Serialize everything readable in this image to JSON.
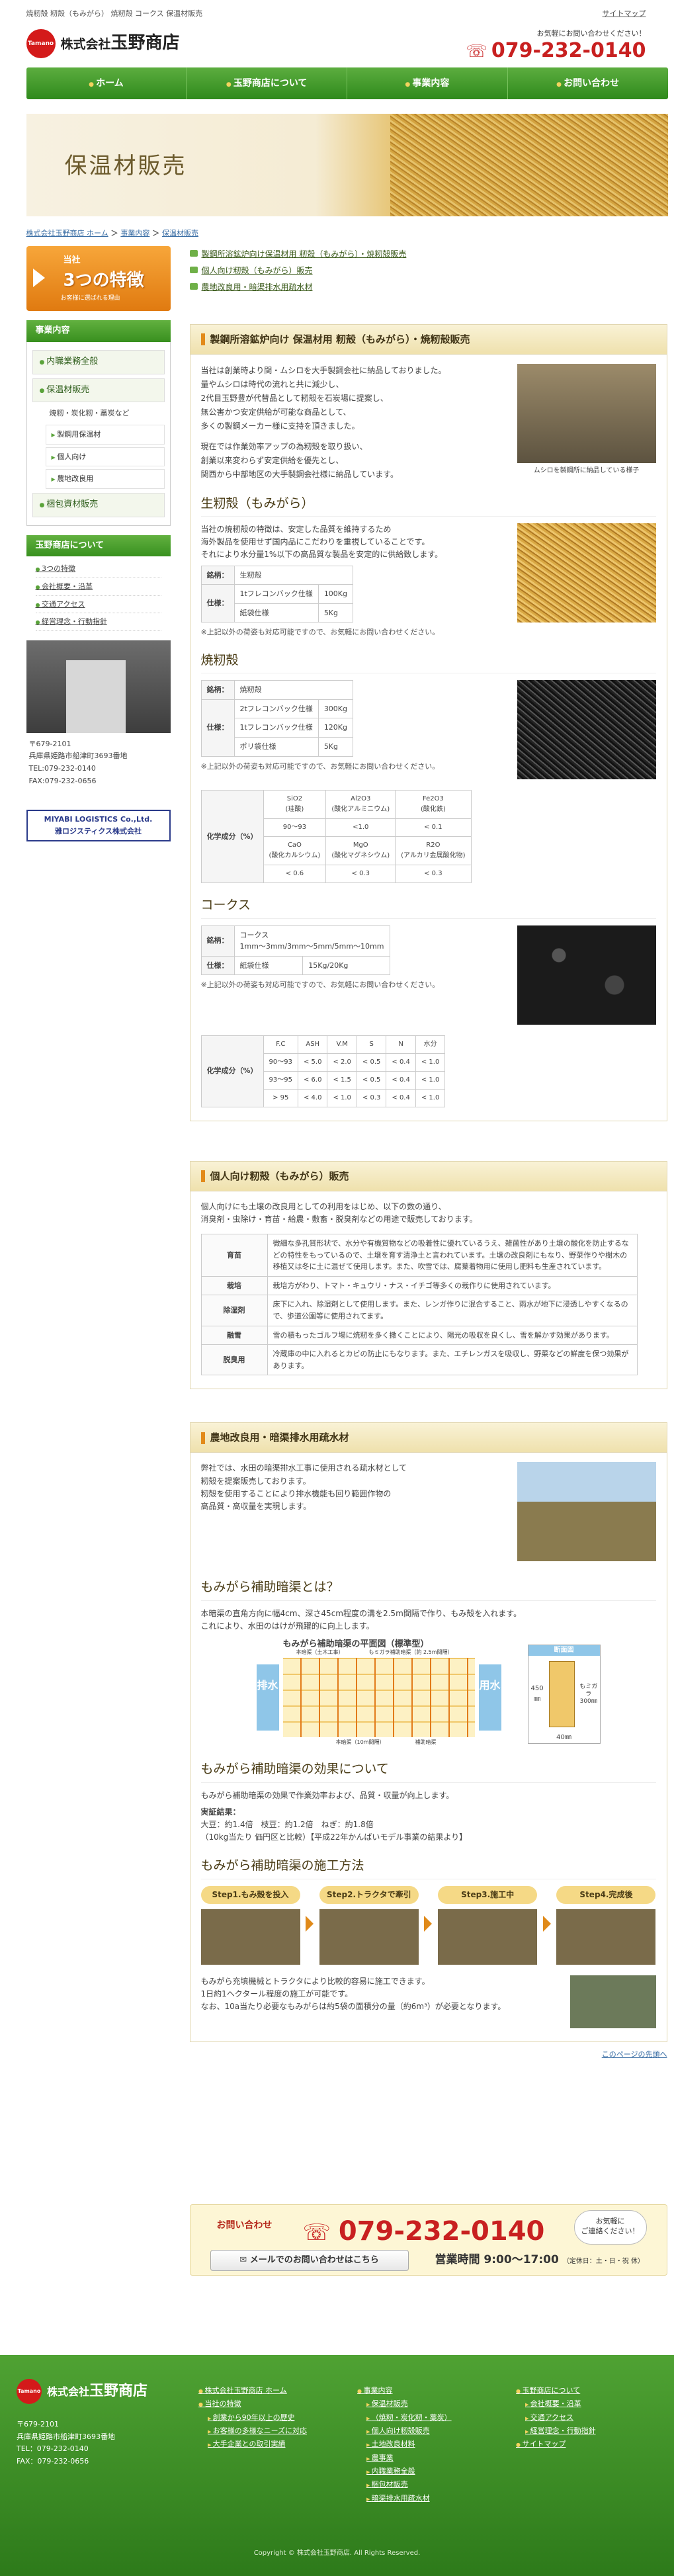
{
  "header": {
    "desc": "焼籾殻 籾殻（もみがら） 焼籾殻 コークス 保温材販売",
    "sitemap": "サイトマップ",
    "logo_mark": "Tamano",
    "company_prefix": "株式会社",
    "company_name": "玉野商店",
    "contact_label": "お気軽にお問い合わせください！",
    "tel": "079-232-0140"
  },
  "nav": [
    "ホーム",
    "玉野商店について",
    "事業内容",
    "お問い合わせ"
  ],
  "hero": {
    "title": "保温材販売"
  },
  "breadcrumb": {
    "home": "株式会社玉野商店 ホーム",
    "sep1": " ＞ ",
    "business": "事業内容",
    "sep2": " ＞ ",
    "current": "保温材販売"
  },
  "sidebar": {
    "three": {
      "line1": "当社",
      "line2": "3つの特徴",
      "line3": "お客様に選ばれる理由"
    },
    "biz_heading": "事業内容",
    "items": [
      {
        "label": "内職業務全般"
      },
      {
        "label": "保温材販売"
      },
      {
        "label": "梱包資材販売"
      }
    ],
    "sub_desc": "焼籾・炭化籾・藁炭など",
    "sub_items": [
      "製鋼用保温材",
      "個人向け",
      "農地改良用"
    ],
    "about_heading": "玉野商店について",
    "about_links": [
      "3つの特徴",
      "会社概要・沿革",
      "交通アクセス",
      "経営理念・行動指針"
    ],
    "addr": [
      "〒679-2101",
      "兵庫県姫路市船津町3693番地",
      "TEL:079-232-0140",
      "FAX:079-232-0656"
    ],
    "miyabi": [
      "MIYABI LOGISTICS Co.,Ltd.",
      "雅ロジスティクス株式会社"
    ]
  },
  "main": {
    "top_links": [
      "製鋼所溶鉱炉向け保温材用 籾殻（もみがら）・焼籾殻販売",
      "個人向け籾殻（もみがら）販売",
      "農地改良用・暗渠排水用疏水材"
    ],
    "sec1": {
      "title": "製鋼所溶鉱炉向け 保温材用 籾殻（もみがら）・焼籾殻販売",
      "intro": [
        "当社は創業時より関・ムシロを大手製鋼会社に納品しておりました。",
        "量やムシロは時代の流れと共に減少し、",
        "2代目玉野豊が代替品として籾殻を石炭場に提案し、",
        "無公害かつ安定供給が可能な商品として、",
        "多くの製鋼メーカー様に支持を頂きました。",
        "",
        "現在では作業効率アップの為籾殻を取り扱い、",
        "創業以来変わらず安定供給を優先とし、",
        "関西から中部地区の大手製鋼会社様に納品しています。"
      ],
      "photo_caption": "ムシロを製鋼所に納品している様子",
      "h_raw": "生籾殻（もみがら）",
      "raw_desc": [
        "当社の焼籾殻の特徴は、安定した品質を維持するため",
        "海外製品を使用せず国内品にこだわりを重視していることです。",
        "それにより水分量1%以下の高品質な製品を安定的に供給致します。"
      ],
      "raw_table": {
        "k1": "銘柄：",
        "v1": "生籾殻",
        "k2": "仕様：",
        "rows": [
          [
            "1tフレコンバック仕様",
            "100Kg"
          ],
          [
            "紙袋仕様",
            "5Kg"
          ]
        ]
      },
      "note": "※上記以外の荷姿も対応可能ですので、お気軽にお問い合わせください。",
      "h_burnt": "焼籾殻",
      "burnt_table": {
        "k1": "銘柄：",
        "v1": "焼籾殻",
        "k2": "仕様：",
        "rows": [
          [
            "2tフレコンバック仕様",
            "300Kg"
          ],
          [
            "1tフレコンバック仕様",
            "120Kg"
          ],
          [
            "ポリ袋仕様",
            "5Kg"
          ]
        ]
      },
      "chem": {
        "label": "化学成分（%）",
        "row1": [
          [
            "SiO2",
            "(珪酸)"
          ],
          [
            "Al2O3",
            "(酸化アルミニウム)"
          ],
          [
            "Fe2O3",
            "(酸化鉄)"
          ]
        ],
        "val1": [
          "90〜93",
          "<1.0",
          "< 0.1"
        ],
        "row2": [
          [
            "CaO",
            "(酸化カルシウム)"
          ],
          [
            "MgO",
            "(酸化マグネシウム)"
          ],
          [
            "R2O",
            "(アルカリ金属酸化物)"
          ]
        ],
        "val2": [
          "< 0.6",
          "< 0.3",
          "< 0.3"
        ]
      },
      "h_coke": "コークス",
      "coke_table": {
        "k1": "銘柄：",
        "v1": "コークス",
        "v1b": "1mm〜3mm/3mm〜5mm/5mm〜10mm",
        "k2": "仕様：",
        "r1": "紙袋仕様",
        "r2": "15Kg/20Kg"
      },
      "coke_chem": {
        "label": "化学成分（%）",
        "head": [
          "F.C",
          "ASH",
          "V.M",
          "S",
          "N",
          "水分"
        ],
        "rows": [
          [
            "90〜93",
            "< 5.0",
            "< 2.0",
            "< 0.5",
            "< 0.4",
            "< 1.0"
          ],
          [
            "93〜95",
            "< 6.0",
            "< 1.5",
            "< 0.5",
            "< 0.4",
            "< 1.0"
          ],
          [
            "> 95",
            "< 4.0",
            "< 1.0",
            "< 0.3",
            "< 0.4",
            "< 1.0"
          ]
        ]
      }
    },
    "sec2": {
      "title": "個人向け籾殻（もみがら）販売",
      "intro": [
        "個人向けにも土壌の改良用としての利用をはじめ、以下の数の通り、",
        "消臭剤・虫除け・育苗・給農・敷畜・脱臭剤などの用途で販売しております。"
      ],
      "rows": [
        [
          "育苗",
          "微細な多孔質形状で、水分や有機質物などの吸着性に優れているうえ、雑菌性があり土壌の酸化を防止するなどの特性をもっているので、土壌を育す清浄土と言われています。土壌の改良剤にもなり、野菜作りや樹木の移植又は冬に土に混ぜて使用します。また、吹雪では、腐葉着物用に使用し肥料も生産されています。"
        ],
        [
          "栽培",
          "栽培方がわり、トマト・キュウリ・ナス・イチゴ等多くの栽作りに使用されています。"
        ],
        [
          "除湿剤",
          "床下に入れ、除湿剤として使用します。また、レンガ作りに混合すること、雨水が地下に浸透しやすくなるので、歩道公園等に使用されてます。"
        ],
        [
          "融雪",
          "雪の積もったゴルフ場に焼籾を多く撒くことにより、陽光の吸収を良くし、雪を解かす効果があります。"
        ],
        [
          "脱臭用",
          "冷蔵庫の中に入れるとカビの防止にもなります。また、エチレンガスを吸収し、野菜などの鮮度を保つ効果があります。"
        ]
      ]
    },
    "sec3": {
      "title": "農地改良用・暗渠排水用疏水材",
      "intro": [
        "弊社では、水田の暗渠排水工事に使用される疏水材として",
        "籾殻を提案販売しております。",
        "籾殻を使用することにより排水機能も回り範囲作物の",
        "高品質・高収量を実現します。"
      ],
      "h_what": "もみがら補助暗渠とは？",
      "what": [
        "本暗渠の直角方向に幅4cm、深さ45cm程度の溝を2.5m間隔で作り、もみ殻を入れます。",
        "これにより、水田のはけが飛躍的に向上します。"
      ],
      "dg": {
        "title": "もみがら補助暗渠の平面図（標準型）",
        "left": "排水",
        "right": "用水",
        "a1": "本暗渠（土木工事）",
        "a2": "もミガラ補助暗渠（約 2.5m間隔）",
        "a3": "本暗渠（10m間隔）",
        "a4": "補助暗渠",
        "sec": "断面図",
        "d1": "450㎜",
        "d2": "もミガラ",
        "d3": "300㎜",
        "d4": "40㎜"
      },
      "h_effect": "もみがら補助暗渠の効果について",
      "effect1": "もみがら補助暗渠の効果で作業効率および、品質・収量が向上します。",
      "effect_h": "実証結果：",
      "effect2": "大豆：約1.4倍　枝豆：約1.2倍　ねぎ：約1.8倍",
      "effect3": "（10kg当たり 価円区と比較）【平成22年かんばいモデル事業の結果より】",
      "h_steps": "もみがら補助暗渠の施工方法",
      "steps": [
        "Step1.もみ殻を投入",
        "Step2.トラクタで牽引",
        "Step3.施工中",
        "Step4.完成後"
      ],
      "after": [
        "もみがら充填機械とトラクタにより比較的容易に施工できます。",
        "1日約1ヘクタール程度の施工が可能です。",
        "なお、10a当たり必要なもみがらは約5袋の面積分の量（約6m³）が必要となります。"
      ]
    },
    "pagetop": "このページの先頭へ"
  },
  "contact": {
    "lead": "お問い合わせ",
    "tel": "079-232-0140",
    "bubble": "お気軽に\nご連絡ください！",
    "mail": "メールでのお問い合わせはこちら",
    "hours": "営業時間 9:00〜17:00",
    "hours_note": "（定休日：土・日・祝 休）"
  },
  "footer": {
    "mark": "Tamano",
    "prefix": "株式会社",
    "name": "玉野商店",
    "addr": [
      "〒679-2101",
      "兵庫県姫路市船津町3693番地",
      "TEL：079-232-0140",
      "FAX：079-232-0656"
    ],
    "col1": [
      [
        "b",
        "株式会社玉野商店 ホーム"
      ],
      [
        "b",
        "当社の特徴"
      ],
      [
        "s",
        "創業から90年以上の歴史"
      ],
      [
        "s",
        "お客様の多様なニーズに対応"
      ],
      [
        "s",
        "大手企業との取引実績"
      ]
    ],
    "col2": [
      [
        "b",
        "事業内容"
      ],
      [
        "s",
        "保温材販売"
      ],
      [
        "s",
        "（焼籾・炭化籾・藁炭）"
      ],
      [
        "s",
        "個人向け籾殻販売"
      ],
      [
        "s",
        "土地改良材料"
      ],
      [
        "s",
        "農事業"
      ],
      [
        "s",
        "内職業務全般"
      ],
      [
        "s",
        "梱包材販売"
      ],
      [
        "s",
        "暗渠排水用疏水材"
      ]
    ],
    "col3": [
      [
        "b",
        "玉野商店について"
      ],
      [
        "s",
        "会社概要・沿革"
      ],
      [
        "s",
        "交通アクセス"
      ],
      [
        "s",
        "経営理念・行動指針"
      ],
      [
        "b",
        "サイトマップ"
      ]
    ],
    "copy": "Copyright ©  株式会社玉野商店. All Rights Reserved."
  }
}
